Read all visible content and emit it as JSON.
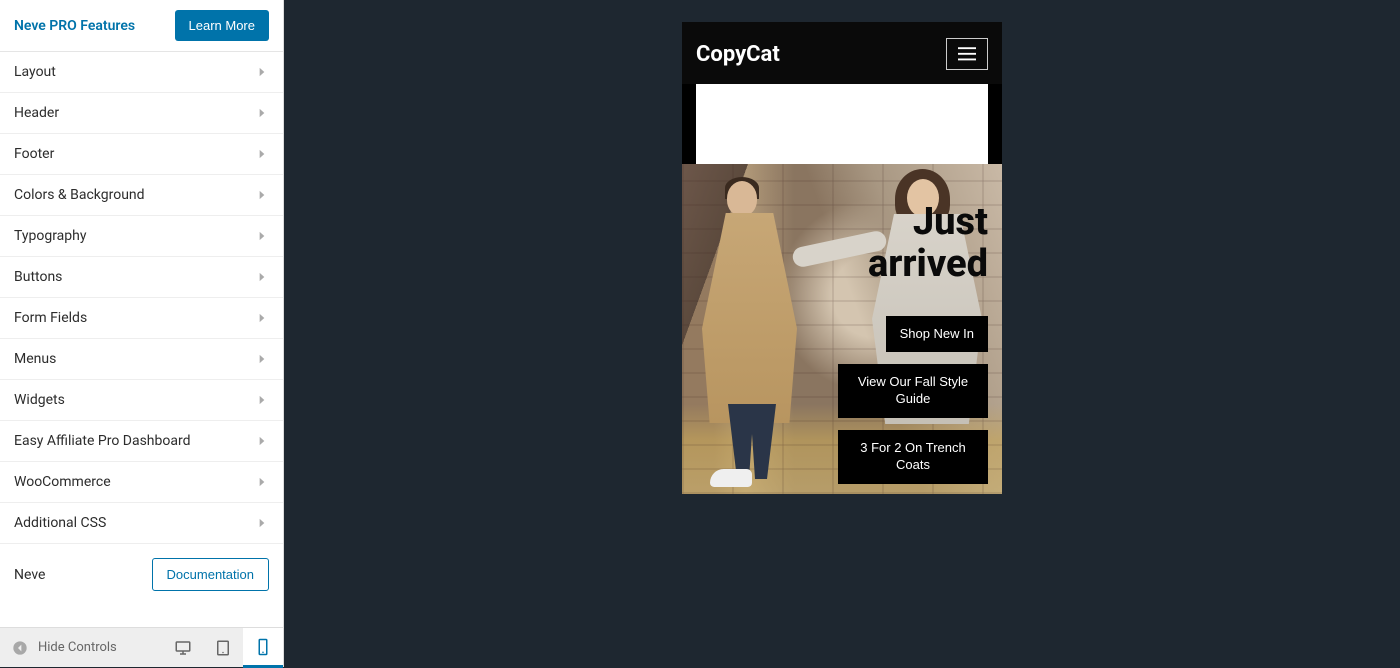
{
  "pro": {
    "title": "Neve PRO Features",
    "button": "Learn More"
  },
  "menu": [
    {
      "label": "Layout"
    },
    {
      "label": "Header"
    },
    {
      "label": "Footer"
    },
    {
      "label": "Colors & Background"
    },
    {
      "label": "Typography"
    },
    {
      "label": "Buttons"
    },
    {
      "label": "Form Fields"
    },
    {
      "label": "Menus"
    },
    {
      "label": "Widgets"
    },
    {
      "label": "Easy Affiliate Pro Dashboard"
    },
    {
      "label": "WooCommerce"
    },
    {
      "label": "Additional CSS"
    }
  ],
  "neve": {
    "label": "Neve",
    "doc_button": "Documentation"
  },
  "bottom": {
    "hide": "Hide Controls"
  },
  "preview": {
    "site_title": "CopyCat",
    "hero_title": "Just arrived",
    "buttons": [
      "Shop New In",
      "View Our Fall Style Guide",
      "3 For 2 On Trench Coats"
    ]
  }
}
